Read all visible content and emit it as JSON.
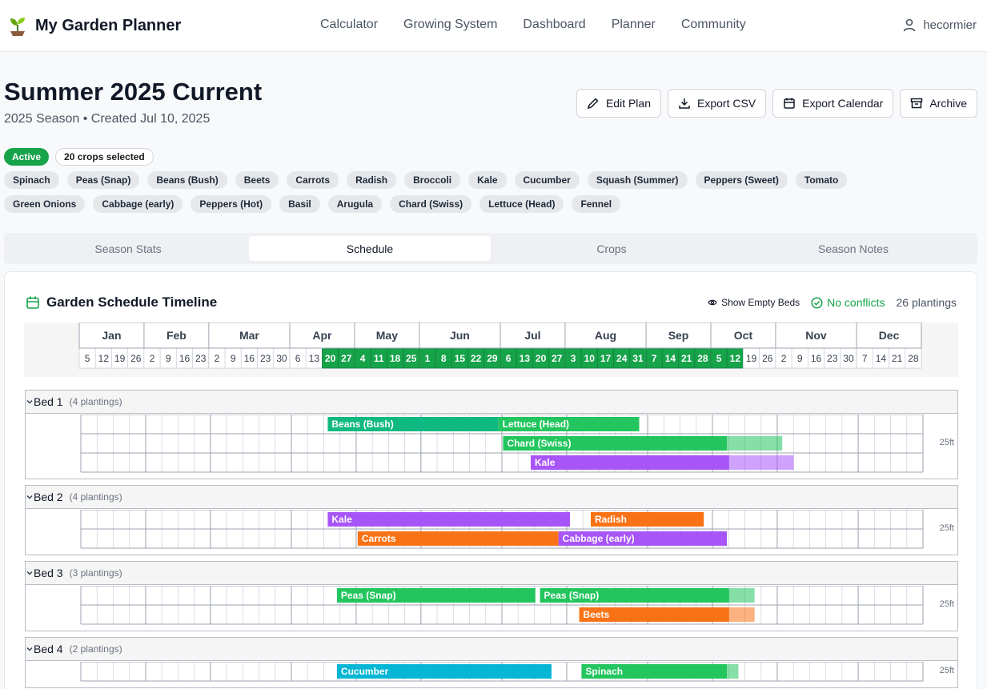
{
  "app": {
    "title": "My Garden Planner"
  },
  "nav": [
    "Calculator",
    "Growing System",
    "Dashboard",
    "Planner",
    "Community"
  ],
  "user": {
    "name": "hecormier"
  },
  "plan": {
    "title": "Summer 2025 Current",
    "subtitle": "2025 Season • Created Jul 10, 2025"
  },
  "actions": {
    "edit": "Edit Plan",
    "export_csv": "Export CSV",
    "export_calendar": "Export Calendar",
    "archive": "Archive"
  },
  "status": {
    "active": "Active",
    "selected": "20 crops selected"
  },
  "crops": [
    "Spinach",
    "Peas (Snap)",
    "Beans (Bush)",
    "Beets",
    "Carrots",
    "Radish",
    "Broccoli",
    "Kale",
    "Cucumber",
    "Squash (Summer)",
    "Peppers (Sweet)",
    "Tomato",
    "Green Onions",
    "Cabbage (early)",
    "Peppers (Hot)",
    "Basil",
    "Arugula",
    "Chard (Swiss)",
    "Lettuce (Head)",
    "Fennel"
  ],
  "tabs": [
    "Season Stats",
    "Schedule",
    "Crops",
    "Season Notes"
  ],
  "active_tab": "Schedule",
  "schedule": {
    "title": "Garden Schedule Timeline",
    "show_empty": "Show Empty Beds",
    "conflicts": "No conflicts",
    "plantings": "26 plantings"
  },
  "colors": {
    "green": "#22c55e",
    "teal": "#10b981",
    "purple": "#a855f7",
    "orange": "#f97316",
    "cyan": "#06b6d4",
    "active_green": "#16a34a"
  },
  "months": [
    {
      "name": "Jan",
      "weeks": [
        "5",
        "12",
        "19",
        "26"
      ],
      "hl": []
    },
    {
      "name": "Feb",
      "weeks": [
        "2",
        "9",
        "16",
        "23"
      ],
      "hl": []
    },
    {
      "name": "Mar",
      "weeks": [
        "2",
        "9",
        "16",
        "23",
        "30"
      ],
      "hl": []
    },
    {
      "name": "Apr",
      "weeks": [
        "6",
        "13",
        "20",
        "27"
      ],
      "hl": [
        "20",
        "27"
      ]
    },
    {
      "name": "May",
      "weeks": [
        "4",
        "11",
        "18",
        "25"
      ],
      "hl": [
        "4",
        "11",
        "18",
        "25"
      ]
    },
    {
      "name": "Jun",
      "weeks": [
        "1",
        "8",
        "15",
        "22",
        "29"
      ],
      "hl": [
        "1",
        "8",
        "15",
        "22",
        "29"
      ]
    },
    {
      "name": "Jul",
      "weeks": [
        "6",
        "13",
        "20",
        "27"
      ],
      "hl": [
        "6",
        "13",
        "20",
        "27"
      ]
    },
    {
      "name": "Aug",
      "weeks": [
        "3",
        "10",
        "17",
        "24",
        "31"
      ],
      "hl": [
        "3",
        "10",
        "17",
        "24",
        "31"
      ]
    },
    {
      "name": "Sep",
      "weeks": [
        "7",
        "14",
        "21",
        "28"
      ],
      "hl": [
        "7",
        "14",
        "21",
        "28"
      ]
    },
    {
      "name": "Oct",
      "weeks": [
        "5",
        "12",
        "19",
        "26"
      ],
      "hl": [
        "5",
        "12"
      ]
    },
    {
      "name": "Nov",
      "weeks": [
        "2",
        "9",
        "16",
        "23",
        "30"
      ],
      "hl": []
    },
    {
      "name": "Dec",
      "weeks": [
        "7",
        "14",
        "21",
        "28"
      ],
      "hl": []
    }
  ],
  "beds": [
    {
      "name": "Bed 1",
      "count": "(4 plantings)",
      "size": "25ft",
      "rows": [
        [
          {
            "crop": "Beans (Bush)",
            "start": "2025-04-18",
            "end": "2025-07-01",
            "color": "teal"
          },
          {
            "crop": "Lettuce (Head)",
            "start": "2025-07-01",
            "end": "2025-08-31",
            "color": "green"
          }
        ],
        [
          {
            "crop": "Chard (Swiss)",
            "start": "2025-07-03",
            "end": "2025-10-08",
            "ext": "2025-11-01",
            "color": "green"
          }
        ],
        [
          {
            "crop": "Kale",
            "start": "2025-07-15",
            "end": "2025-10-09",
            "ext": "2025-11-06",
            "color": "purple"
          }
        ]
      ]
    },
    {
      "name": "Bed 2",
      "count": "(4 plantings)",
      "size": "25ft",
      "rows": [
        [
          {
            "crop": "Kale",
            "start": "2025-04-18",
            "end": "2025-08-01",
            "color": "purple"
          },
          {
            "crop": "Radish",
            "start": "2025-08-10",
            "end": "2025-09-28",
            "color": "orange"
          }
        ],
        [
          {
            "crop": "Carrots",
            "start": "2025-05-01",
            "end": "2025-07-27",
            "color": "orange"
          },
          {
            "crop": "Cabbage (early)",
            "start": "2025-07-27",
            "end": "2025-10-08",
            "color": "purple"
          }
        ]
      ]
    },
    {
      "name": "Bed 3",
      "count": "(3 plantings)",
      "size": "25ft",
      "rows": [
        [
          {
            "crop": "Peas (Snap)",
            "start": "2025-04-22",
            "end": "2025-07-17",
            "color": "green"
          },
          {
            "crop": "Peas (Snap)",
            "start": "2025-07-19",
            "end": "2025-10-09",
            "ext": "2025-10-20",
            "color": "green"
          }
        ],
        [
          {
            "crop": "Beets",
            "start": "2025-08-05",
            "end": "2025-10-09",
            "ext": "2025-10-20",
            "color": "orange"
          }
        ]
      ]
    },
    {
      "name": "Bed 4",
      "count": "(2 plantings)",
      "size": "25ft",
      "rows": [
        [
          {
            "crop": "Cucumber",
            "start": "2025-04-22",
            "end": "2025-07-24",
            "color": "cyan"
          },
          {
            "crop": "Spinach",
            "start": "2025-08-06",
            "end": "2025-10-08",
            "ext": "2025-10-13",
            "color": "green"
          }
        ]
      ]
    }
  ]
}
